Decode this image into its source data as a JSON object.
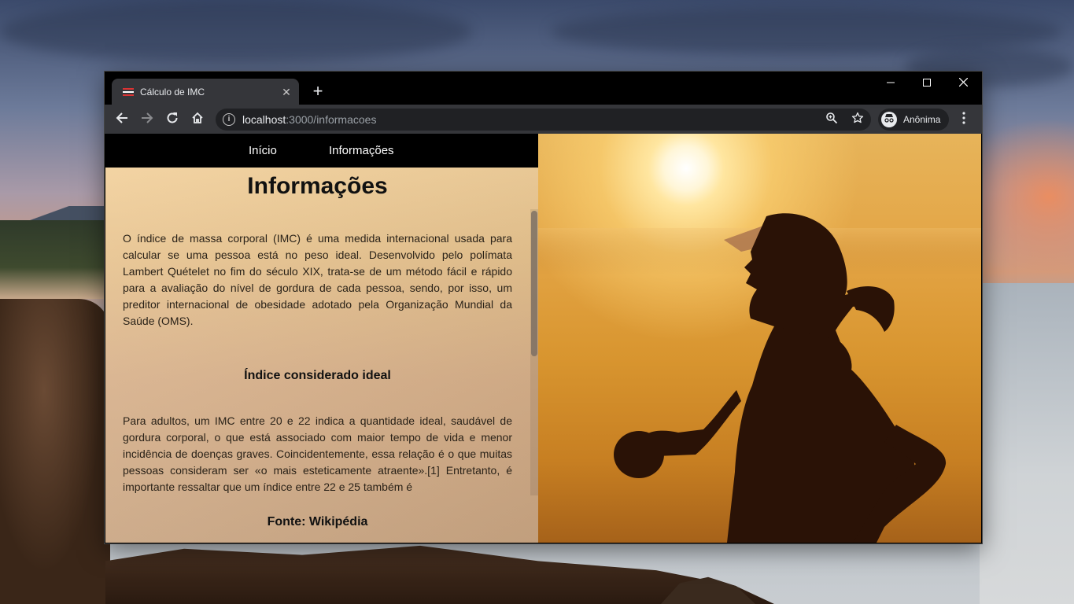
{
  "browser": {
    "tab_title": "Cálculo de IMC",
    "tab_close": "✕",
    "new_tab": "+",
    "url_host": "localhost",
    "url_path": ":3000/informacoes",
    "profile_label": "Anônima",
    "window_controls": {
      "minimize": "—",
      "maximize": "☐",
      "close": "✕"
    }
  },
  "nav": {
    "items": [
      {
        "label": "Início"
      },
      {
        "label": "Informações"
      }
    ]
  },
  "page": {
    "title": "Informações",
    "paragraph1": "O índice de massa corporal (IMC) é uma medida internacional usada para calcular se uma pessoa está no peso ideal. Desenvolvido pelo polímata Lambert Quételet no fim do século XIX, trata-se de um método fácil e rápido para a avaliação do nível de gordura de cada pessoa, sendo, por isso, um preditor internacional de obesidade adotado pela Organização Mundial da Saúde (OMS).",
    "subtitle": "Índice considerado ideal",
    "paragraph2": "Para adultos, um IMC entre 20 e 22 indica a quantidade ideal, saudável de gordura corporal, o que está associado com maior tempo de vida e menor incidência de doenças graves. Coincidentemente, essa relação é o que muitas pessoas consideram ser «o mais esteticamente atraente».[1] Entretanto, é importante ressaltar que um índice entre 22 e 25 também é",
    "source": "Fonte: Wikipédia"
  },
  "icons": {
    "back": "back-arrow-icon",
    "forward": "forward-arrow-icon",
    "reload": "reload-icon",
    "home": "home-icon",
    "info": "info-icon",
    "zoom": "zoom-icon",
    "bookmark": "star-icon",
    "menu": "kebab-menu-icon"
  }
}
